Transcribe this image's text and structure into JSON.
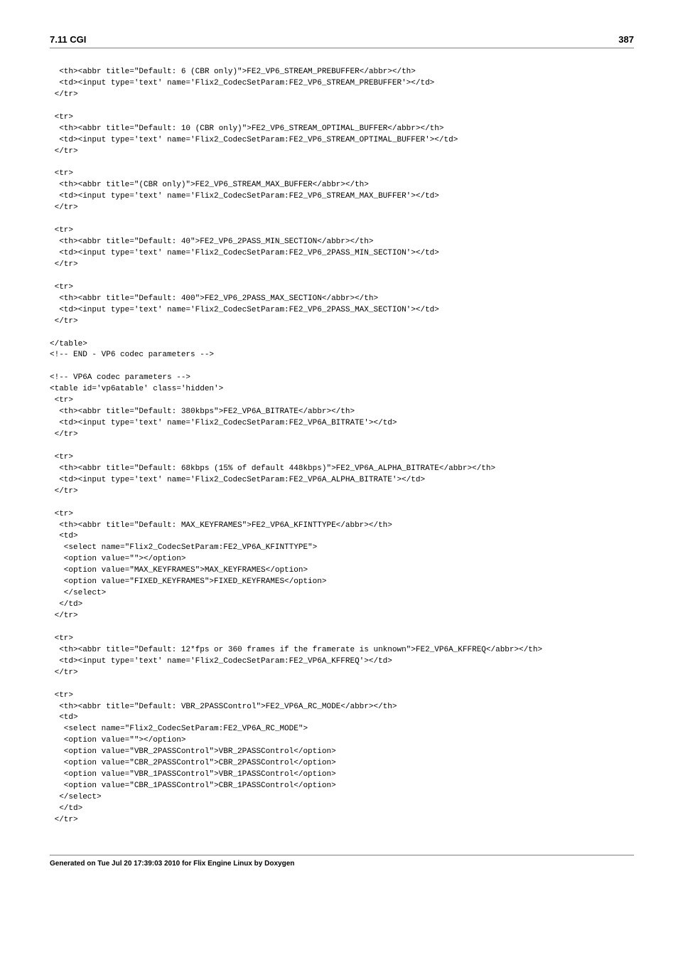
{
  "header": {
    "left": "7.11 CGI",
    "right": "387"
  },
  "code": "  <th><abbr title=\"Default: 6 (CBR only)\">FE2_VP6_STREAM_PREBUFFER</abbr></th>\n  <td><input type='text' name='Flix2_CodecSetParam:FE2_VP6_STREAM_PREBUFFER'></td>\n </tr>\n\n <tr>\n  <th><abbr title=\"Default: 10 (CBR only)\">FE2_VP6_STREAM_OPTIMAL_BUFFER</abbr></th>\n  <td><input type='text' name='Flix2_CodecSetParam:FE2_VP6_STREAM_OPTIMAL_BUFFER'></td>\n </tr>\n\n <tr>\n  <th><abbr title=\"(CBR only)\">FE2_VP6_STREAM_MAX_BUFFER</abbr></th>\n  <td><input type='text' name='Flix2_CodecSetParam:FE2_VP6_STREAM_MAX_BUFFER'></td>\n </tr>\n\n <tr>\n  <th><abbr title=\"Default: 40\">FE2_VP6_2PASS_MIN_SECTION</abbr></th>\n  <td><input type='text' name='Flix2_CodecSetParam:FE2_VP6_2PASS_MIN_SECTION'></td>\n </tr>\n\n <tr>\n  <th><abbr title=\"Default: 400\">FE2_VP6_2PASS_MAX_SECTION</abbr></th>\n  <td><input type='text' name='Flix2_CodecSetParam:FE2_VP6_2PASS_MAX_SECTION'></td>\n </tr>\n\n</table>\n<!-- END - VP6 codec parameters -->\n\n<!-- VP6A codec parameters -->\n<table id='vp6atable' class='hidden'>\n <tr>\n  <th><abbr title=\"Default: 380kbps\">FE2_VP6A_BITRATE</abbr></th>\n  <td><input type='text' name='Flix2_CodecSetParam:FE2_VP6A_BITRATE'></td>\n </tr>\n\n <tr>\n  <th><abbr title=\"Default: 68kbps (15% of default 448kbps)\">FE2_VP6A_ALPHA_BITRATE</abbr></th>\n  <td><input type='text' name='Flix2_CodecSetParam:FE2_VP6A_ALPHA_BITRATE'></td>\n </tr>\n\n <tr>\n  <th><abbr title=\"Default: MAX_KEYFRAMES\">FE2_VP6A_KFINTTYPE</abbr></th>\n  <td>\n   <select name=\"Flix2_CodecSetParam:FE2_VP6A_KFINTTYPE\">\n   <option value=\"\"></option>\n   <option value=\"MAX_KEYFRAMES\">MAX_KEYFRAMES</option>\n   <option value=\"FIXED_KEYFRAMES\">FIXED_KEYFRAMES</option>\n   </select>\n  </td>\n </tr>\n\n <tr>\n  <th><abbr title=\"Default: 12*fps or 360 frames if the framerate is unknown\">FE2_VP6A_KFFREQ</abbr></th>\n  <td><input type='text' name='Flix2_CodecSetParam:FE2_VP6A_KFFREQ'></td>\n </tr>\n\n <tr>\n  <th><abbr title=\"Default: VBR_2PASSControl\">FE2_VP6A_RC_MODE</abbr></th>\n  <td>\n   <select name=\"Flix2_CodecSetParam:FE2_VP6A_RC_MODE\">\n   <option value=\"\"></option>\n   <option value=\"VBR_2PASSControl\">VBR_2PASSControl</option>\n   <option value=\"CBR_2PASSControl\">CBR_2PASSControl</option>\n   <option value=\"VBR_1PASSControl\">VBR_1PASSControl</option>\n   <option value=\"CBR_1PASSControl\">CBR_1PASSControl</option>\n  </select>\n  </td>\n </tr>",
  "footer": "Generated on Tue Jul 20 17:39:03 2010 for Flix Engine Linux by Doxygen"
}
